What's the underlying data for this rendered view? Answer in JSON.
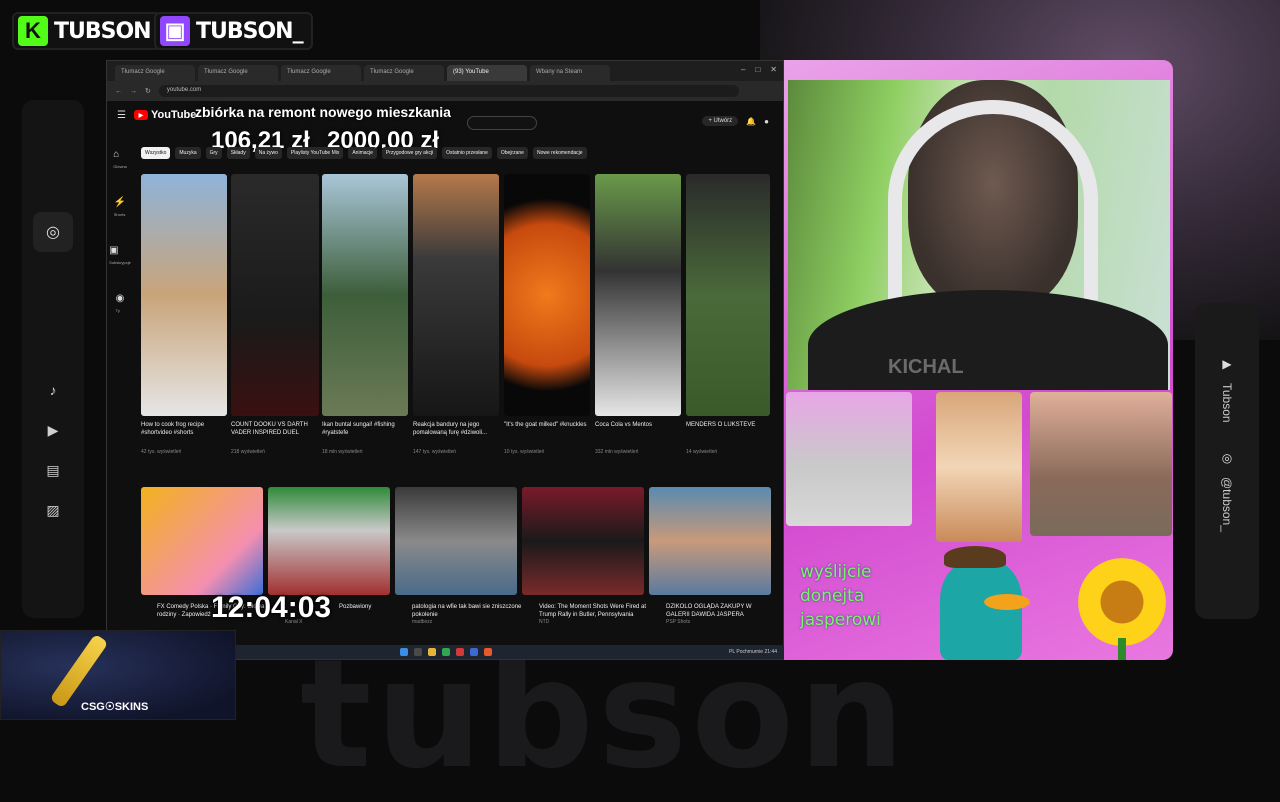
{
  "stream": {
    "kick_name": "TUBSON",
    "twitch_name": "TUBSON_",
    "bg_word": "tubson",
    "socials": [
      {
        "icon": "youtube-icon",
        "label": "Tubson"
      },
      {
        "icon": "instagram-icon",
        "label": "@tubson_"
      }
    ],
    "donation_title": "zbiórka na remont nowego mieszkania",
    "donation_current": "106,21 zł",
    "donation_goal": "2000,00 zł",
    "clock": "12:04:03",
    "cam_watermark": "KICHAL",
    "overlay_text": "wyślijcie\ndonejta\njasperowi",
    "sponsor": "CSG☉SKINS"
  },
  "browser": {
    "tabs": [
      "Tłumacz Google",
      "Tłumacz Google",
      "Tłumacz Google",
      "Tłumacz Google",
      "(93) YouTube",
      "Wbany na Steam"
    ],
    "url": "youtube.com",
    "yt_logo": "YouTube",
    "create_label": "+ Utwórz",
    "side_items": [
      "Główna",
      "Shorts",
      "Subskrypcje",
      "Ty"
    ],
    "chips": [
      "Wszystko",
      "Muzyka",
      "Gry",
      "Składy",
      "Na żywo",
      "Playlisty YouTube Mix",
      "Animacje",
      "Przygodowe gry akcji",
      "Ostatnio przesłane",
      "Obejrzane",
      "Nowe rekomendacje"
    ],
    "shorts": [
      {
        "title": "How to cook frog recipe #shortvideo #shorts",
        "views": "42 tys. wyświetleń"
      },
      {
        "title": "COUNT DOOKU VS DARTH VADER INSPIRED DUEL",
        "views": "218 wyświetleń"
      },
      {
        "title": "Ikan buntal sungai! #fishing #ryatstefe",
        "views": "18 mln wyświetleń"
      },
      {
        "title": "Reakcja bandury na jego pomalowaną furę #dziwoli...",
        "views": "147 tys. wyświetleń"
      },
      {
        "title": "\"It's the goat milked\" #knuckles",
        "views": "10 tys. wyświetleń"
      },
      {
        "title": "Coca Cola vs Mentos",
        "views": "332 mln wyświetleń"
      },
      {
        "title": "MENDERS O LUKSTEVE",
        "views": "14 wyświetleń"
      }
    ],
    "videos": [
      {
        "title": "FX Comedy Polska · Family Guy: Głowa rodziny · Zapowiedź",
        "channel": "FX Comedy Polska"
      },
      {
        "title": "Pozbawiony",
        "channel": "Kanał X"
      },
      {
        "title": "patologia na wfie tak bawi sie zniszczone pokolenie",
        "channel": "madbozz"
      },
      {
        "title": "Video: The Moment Shots Were Fired at Trump Rally in Butler, Pennsylvania",
        "channel": "NTD"
      },
      {
        "title": "DZIKOLO OGLĄDA ZAKUPY W GALERII DAWIDA JASPERA",
        "channel": "PSP Shots"
      }
    ],
    "tray": "PL Pochmurnie   21:44"
  }
}
